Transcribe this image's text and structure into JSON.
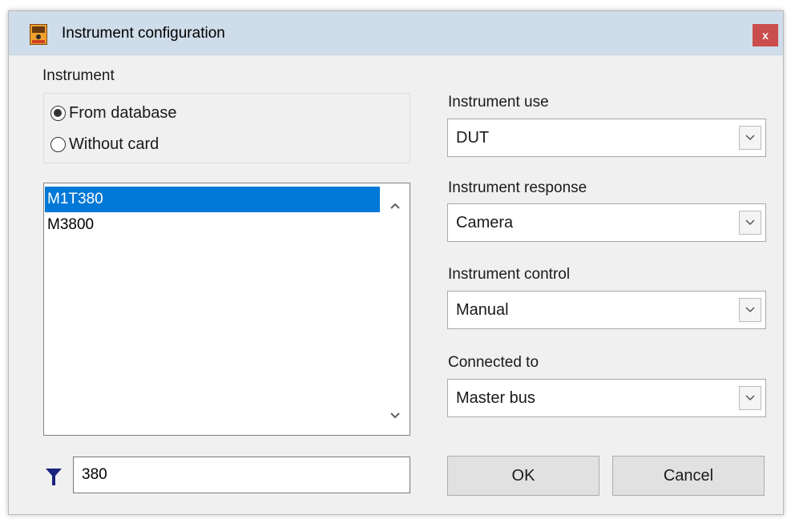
{
  "window": {
    "title": "Instrument configuration",
    "close_glyph": "x"
  },
  "instrument": {
    "group_label": "Instrument",
    "options": [
      {
        "label": "From database",
        "checked": true
      },
      {
        "label": "Without card",
        "checked": false
      }
    ],
    "list": [
      "M1T380",
      "M3800"
    ],
    "selected_index": 0,
    "filter_value": "380",
    "filter_icon": "funnel-icon"
  },
  "fields": {
    "use": {
      "label": "Instrument use",
      "value": "DUT"
    },
    "response": {
      "label": "Instrument response",
      "value": "Camera"
    },
    "control": {
      "label": "Instrument control",
      "value": "Manual"
    },
    "connected": {
      "label": "Connected to",
      "value": "Master bus"
    }
  },
  "buttons": {
    "ok": "OK",
    "cancel": "Cancel"
  },
  "colors": {
    "selection": "#0078d7",
    "close": "#c94d4d",
    "titlebar": "#cfdcea",
    "filter_icon": "#1a237e"
  }
}
